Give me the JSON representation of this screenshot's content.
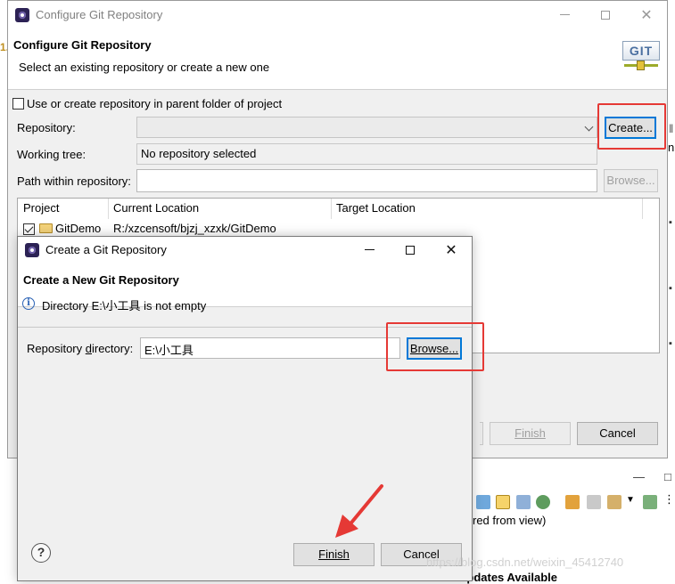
{
  "main_window": {
    "title": "Configure Git Repository",
    "banner_title": "Configure Git Repository",
    "banner_desc": "Select an existing repository or create a new one",
    "logo_text": "GIT",
    "use_parent_checkbox_label": "Use or create repository in parent folder of project",
    "repository_label": "Repository:",
    "repository_value": "",
    "create_button": "Create...",
    "working_tree_label": "Working tree:",
    "working_tree_value": "No repository selected",
    "path_label": "Path within repository:",
    "path_value": "",
    "browse_button": "Browse...",
    "table": {
      "columns": [
        "Project",
        "Current Location",
        "Target Location"
      ],
      "rows": [
        {
          "project": "GitDemo",
          "current": "R:/xzcensoft/bjzj_xzxk/GitDemo",
          "target": ""
        }
      ]
    },
    "finish_button": "Finish",
    "cancel_button": "Cancel"
  },
  "dialog": {
    "title": "Create a Git Repository",
    "banner_title": "Create a New Git Repository",
    "info_message": "Directory E:\\小工具 is not empty",
    "repo_dir_label": "Repository directory:",
    "repo_dir_value": "E:\\小工具",
    "browse_button": "Browse...",
    "finish_button": "Finish",
    "cancel_button": "Cancel"
  },
  "background": {
    "view_text": "red from view)",
    "updates_text": "Updates Available",
    "watermark": "https://blog.csdn.net/weixin_45412740"
  },
  "colors": {
    "highlight": "#e53935",
    "focus": "#0078d7",
    "info": "#2a62b5"
  }
}
